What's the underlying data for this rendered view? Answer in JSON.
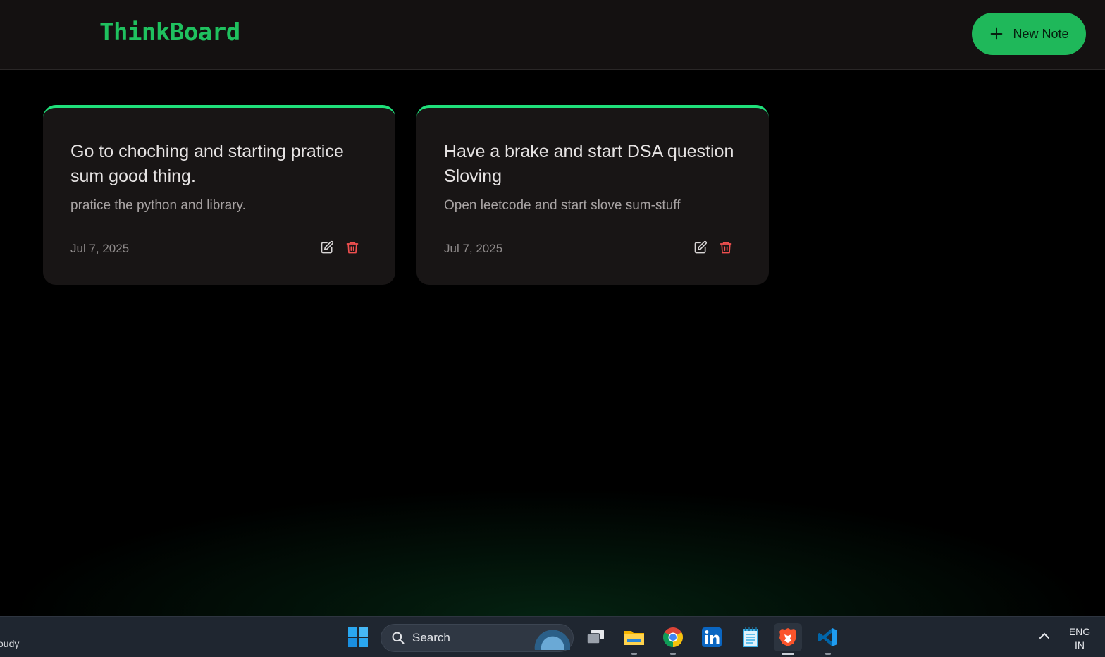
{
  "app": {
    "brand": "ThinkBoard",
    "new_note_label": "New Note",
    "accent": "#1fc15f"
  },
  "notes": [
    {
      "title": "Go to choching and starting pratice sum good thing.",
      "body": "pratice the python and library.",
      "date": "Jul 7, 2025"
    },
    {
      "title": "Have a brake and start DSA question Sloving",
      "body": "Open leetcode and start slove sum-stuff",
      "date": "Jul 7, 2025"
    }
  ],
  "taskbar": {
    "weather_text": "oudy",
    "search_label": "Search",
    "language_line1": "ENG",
    "language_line2": "IN",
    "apps": [
      "windows-start-icon",
      "task-view-icon",
      "file-explorer-icon",
      "chrome-icon",
      "linkedin-icon",
      "notepad-icon",
      "brave-icon",
      "vscode-icon"
    ]
  }
}
